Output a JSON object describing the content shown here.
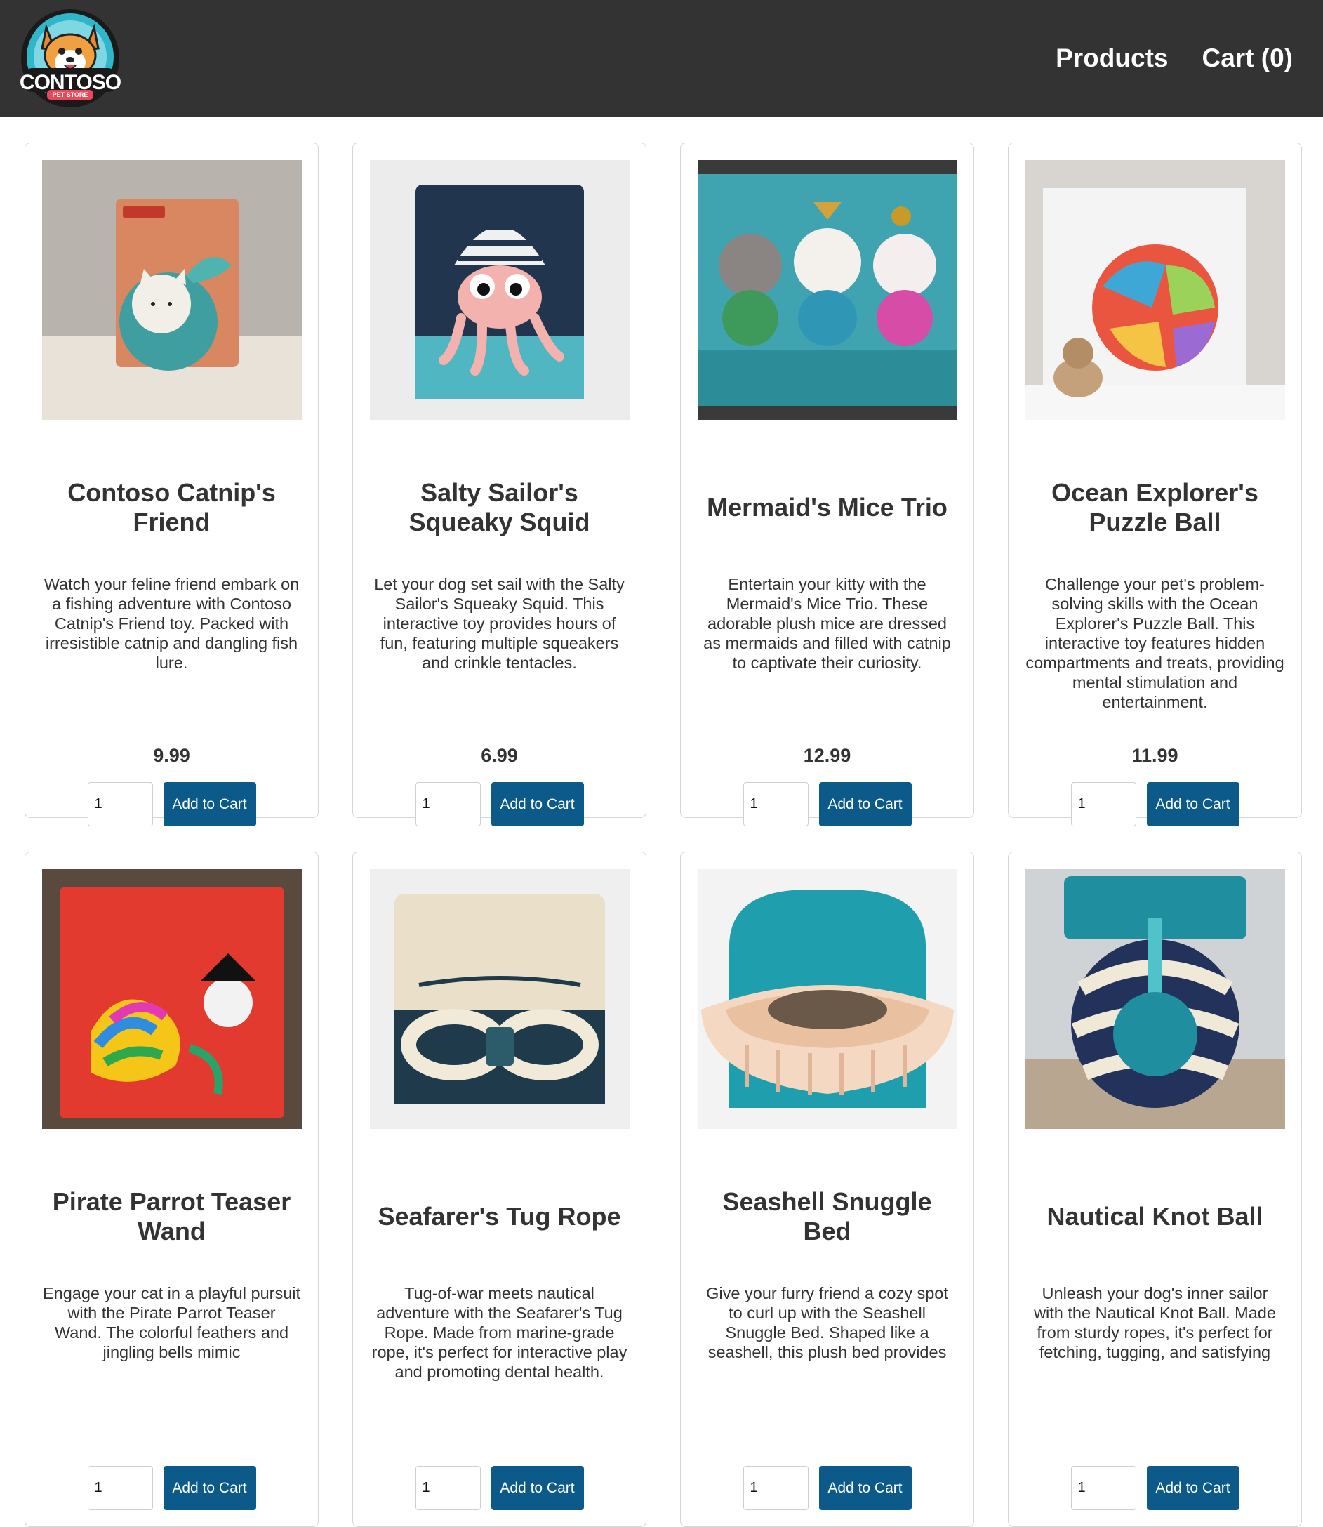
{
  "header": {
    "logo_text": "CONTOSO",
    "logo_sub": "PET STORE",
    "nav": {
      "products": "Products",
      "cart": "Cart (0)"
    }
  },
  "products": [
    {
      "title": "Contoso Catnip's Friend",
      "description": "Watch your feline friend embark on a fishing adventure with Contoso Catnip's Friend toy. Packed with irresistible catnip and dangling fish lure.",
      "price": "9.99",
      "quantity": "1",
      "button": "Add to Cart",
      "image_icon": "cat-ball-toy-icon"
    },
    {
      "title": "Salty Sailor's Squeaky Squid",
      "description": "Let your dog set sail with the Salty Sailor's Squeaky Squid. This interactive toy provides hours of fun, featuring multiple squeakers and crinkle tentacles.",
      "price": "6.99",
      "quantity": "1",
      "button": "Add to Cart",
      "image_icon": "squid-toy-icon"
    },
    {
      "title": "Mermaid's Mice Trio",
      "description": "Entertain your kitty with the Mermaid's Mice Trio. These adorable plush mice are dressed as mermaids and filled with catnip to captivate their curiosity.",
      "price": "12.99",
      "quantity": "1",
      "button": "Add to Cart",
      "image_icon": "mermaid-mice-icon"
    },
    {
      "title": "Ocean Explorer's Puzzle Ball",
      "description": "Challenge your pet's problem-solving skills with the Ocean Explorer's Puzzle Ball. This interactive toy features hidden compartments and treats, providing mental stimulation and entertainment.",
      "price": "11.99",
      "quantity": "1",
      "button": "Add to Cart",
      "image_icon": "puzzle-ball-icon"
    },
    {
      "title": "Pirate Parrot Teaser Wand",
      "description": "Engage your cat in a playful pursuit with the Pirate Parrot Teaser Wand. The colorful feathers and jingling bells mimic",
      "price": "",
      "quantity": "1",
      "button": "Add to Cart",
      "image_icon": "feather-wand-icon"
    },
    {
      "title": "Seafarer's Tug Rope",
      "description": "Tug-of-war meets nautical adventure with the Seafarer's Tug Rope. Made from marine-grade rope, it's perfect for interactive play and promoting dental health.",
      "price": "",
      "quantity": "1",
      "button": "Add to Cart",
      "image_icon": "tug-rope-icon"
    },
    {
      "title": "Seashell Snuggle Bed",
      "description": "Give your furry friend a cozy spot to curl up with the Seashell Snuggle Bed. Shaped like a seashell, this plush bed provides",
      "price": "",
      "quantity": "1",
      "button": "Add to Cart",
      "image_icon": "seashell-bed-icon"
    },
    {
      "title": "Nautical Knot Ball",
      "description": "Unleash your dog's inner sailor with the Nautical Knot Ball. Made from sturdy ropes, it's perfect for fetching, tugging, and satisfying",
      "price": "",
      "quantity": "1",
      "button": "Add to Cart",
      "image_icon": "knot-ball-icon"
    }
  ],
  "colors": {
    "topbar": "#333333",
    "button": "#0b5a8a",
    "card_border": "#d6d6d6"
  }
}
